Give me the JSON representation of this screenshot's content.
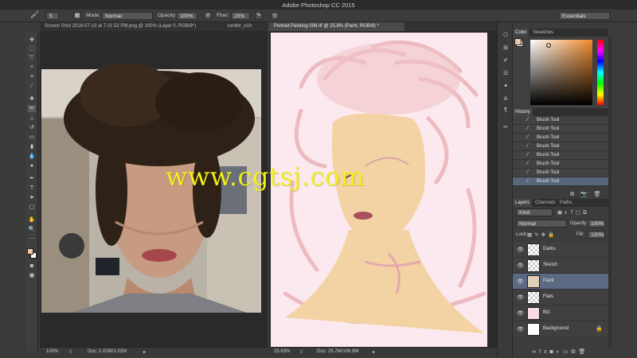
{
  "app": {
    "title": "Adobe Photoshop CC 2015"
  },
  "options": {
    "mode_label": "Mode:",
    "mode_value": "Normal",
    "opacity_label": "Opacity:",
    "opacity_value": "100%",
    "flow_label": "Flow:",
    "flow_value": "15%",
    "brush_size": "5",
    "workspace": "Essentials"
  },
  "documents": [
    {
      "title": "Screen Shot 2016-07-13 at 7.01.52 PM.png @ 100% (Layer 0, RGB/8*)",
      "active": false
    },
    {
      "title": "tumblr_o1h",
      "active": false
    },
    {
      "title": "Portrait Painting 006.tif @ 25.8% (Paint, RGB/8) *",
      "active": true
    }
  ],
  "status_left": {
    "zoom": "100%",
    "doc": "Doc: 1.02M/1.02M"
  },
  "status_right": {
    "zoom": "25.83%",
    "doc": "Doc: 25.7M/106.9M"
  },
  "color_panel": {
    "tabs": [
      "Color",
      "Swatches"
    ],
    "foreground": "#f0c7a7",
    "background": "#ffffff"
  },
  "history": {
    "title": "History",
    "items": [
      "Brush Tool",
      "Brush Tool",
      "Brush Tool",
      "Brush Tool",
      "Brush Tool",
      "Brush Tool",
      "Brush Tool",
      "Brush Tool"
    ]
  },
  "layers_panel": {
    "tabs": [
      "Layers",
      "Channels",
      "Paths"
    ],
    "kind": "Kind",
    "blend": "Normal",
    "opacity_label": "Opacity:",
    "opacity": "100%",
    "lock_label": "Lock:",
    "fill_label": "Fill:",
    "fill": "100%",
    "layers": [
      {
        "name": "Darks",
        "thumb": "checker"
      },
      {
        "name": "Sketch",
        "thumb": "checker"
      },
      {
        "name": "Paint",
        "thumb": "paint",
        "selected": true
      },
      {
        "name": "Flats",
        "thumb": "checker"
      },
      {
        "name": "BG",
        "thumb": "#f7dbe6"
      },
      {
        "name": "Background",
        "thumb": "#ffffff",
        "locked": true
      }
    ]
  },
  "watermark": "www.cgtsj.com"
}
